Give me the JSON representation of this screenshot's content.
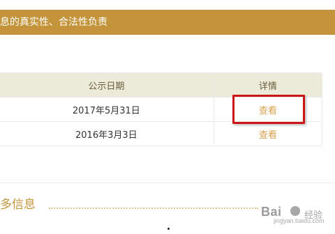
{
  "notice": {
    "text": "息的真实性、合法性负责"
  },
  "table": {
    "headers": {
      "date": "公示日期",
      "detail": "详情"
    },
    "rows": [
      {
        "date": "2017年5月31日",
        "detail_link": "查看"
      },
      {
        "date": "2016年3月3日",
        "detail_link": "查看"
      }
    ]
  },
  "more_info": {
    "title": "多信息"
  },
  "watermark": {
    "brand": "Bai",
    "jingyan": "经验",
    "url": "jingyan.baidu.com"
  },
  "colors": {
    "accent": "#c4943b",
    "link": "#d8a14e",
    "highlight": "#cc1616",
    "header_bg": "#ecebd9"
  }
}
